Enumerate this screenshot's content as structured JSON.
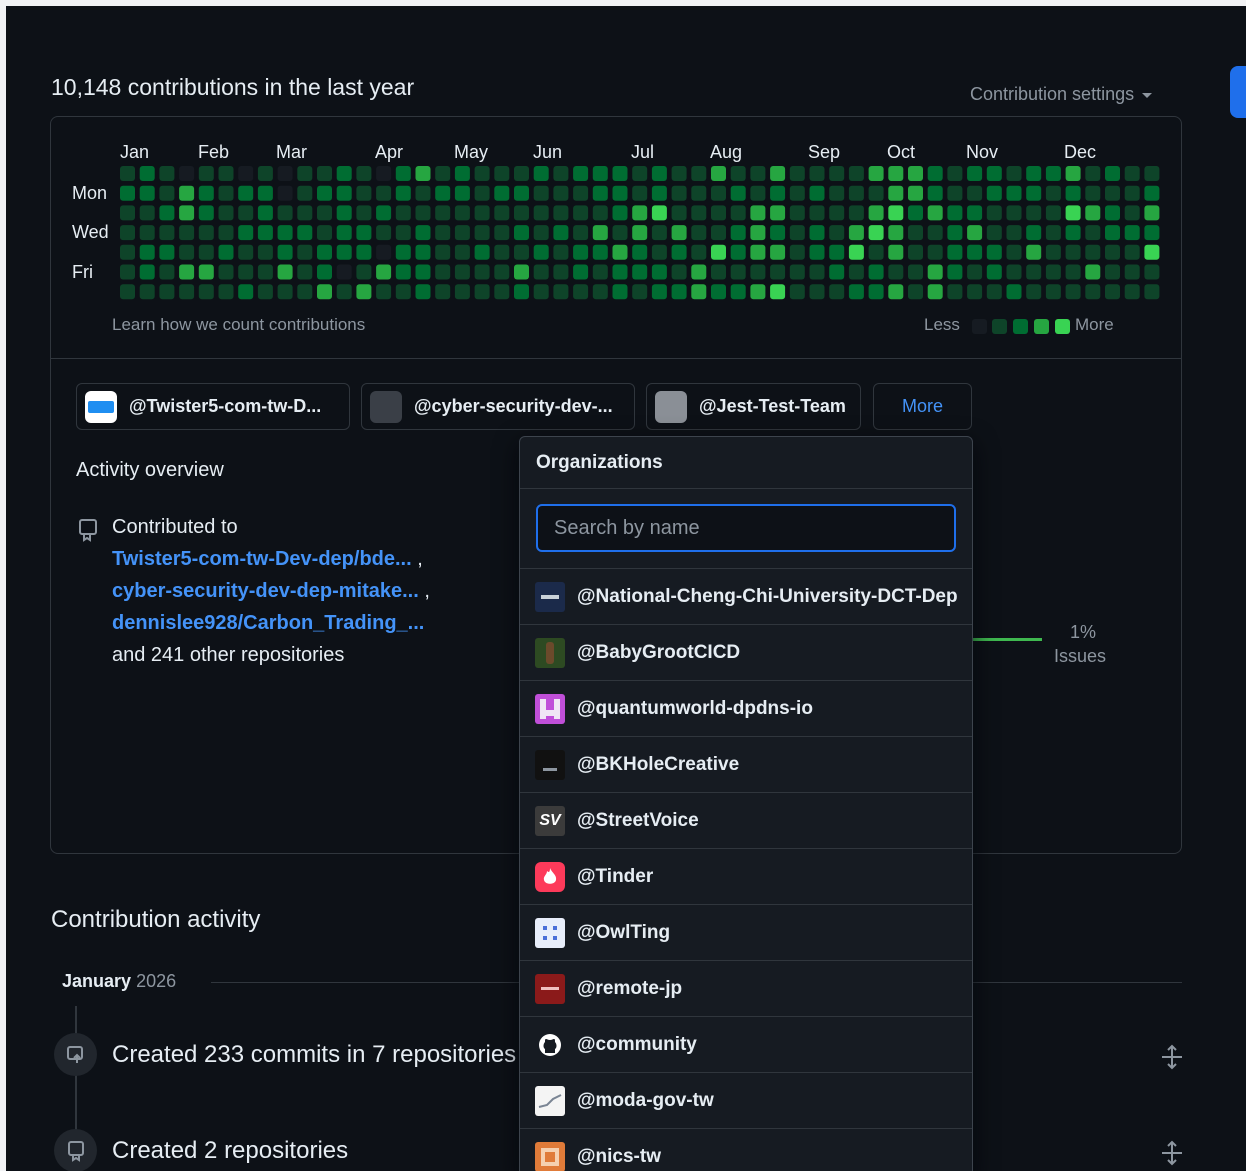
{
  "header": {
    "title": "10,148 contributions in the last year",
    "settings_label": "Contribution settings"
  },
  "calendar": {
    "months": [
      "Jan",
      "Feb",
      "Mar",
      "Apr",
      "May",
      "Jun",
      "Jul",
      "Aug",
      "Sep",
      "Oct",
      "Nov",
      "Dec"
    ],
    "days": [
      "Mon",
      "Wed",
      "Fri"
    ],
    "learn_link": "Learn how we count contributions",
    "legend_less": "Less",
    "legend_more": "More",
    "colors": [
      "#161b22",
      "#0e4429",
      "#006d32",
      "#26a641",
      "#39d353"
    ]
  },
  "org_filters": [
    {
      "label": "@Twister5-com-tw-D...",
      "avatar_color": "#1f8ef1"
    },
    {
      "label": "@cyber-security-dev-...",
      "avatar_color": "#3a3f47"
    },
    {
      "label": "@Jest-Test-Team",
      "avatar_color": "#8a8f96"
    }
  ],
  "more_button": "More",
  "activity": {
    "title": "Activity overview",
    "contributed_to": "Contributed to",
    "repos": [
      "Twister5-com-tw-Dev-dep/bde...",
      "cyber-security-dev-dep-mitake...",
      "dennislee928/Carbon_Trading_..."
    ],
    "comma": ",",
    "others": "and 241 other repositories",
    "issues_pct": "1%",
    "issues_label": "Issues"
  },
  "contribution_activity": {
    "title": "Contribution activity",
    "month": "January",
    "year": "2026",
    "items": [
      {
        "text": "Created 233 commits in 7 repositories"
      },
      {
        "text": "Created 2 repositories"
      }
    ]
  },
  "dropdown": {
    "title": "Organizations",
    "search_placeholder": "Search by name",
    "items": [
      {
        "name": "@National-Cheng-Chi-University-DCT-Dep",
        "icon": "nccu-logo-icon",
        "color": "#1b2a4a"
      },
      {
        "name": "@BabyGrootCICD",
        "icon": "groot-avatar-icon",
        "color": "#2d4a22"
      },
      {
        "name": "@quantumworld-dpdns-io",
        "icon": "quantumworld-identicon",
        "color": "#c04fd9"
      },
      {
        "name": "@BKHoleCreative",
        "icon": "bkhole-logo-icon",
        "color": "#111111"
      },
      {
        "name": "@StreetVoice",
        "icon": "streetvoice-logo-icon",
        "color": "#3b3b3b"
      },
      {
        "name": "@Tinder",
        "icon": "tinder-flame-icon",
        "color": "#fd3a5a"
      },
      {
        "name": "@OwlTing",
        "icon": "owlting-logo-icon",
        "color": "#e8eefb"
      },
      {
        "name": "@remote-jp",
        "icon": "remote-jp-logo-icon",
        "color": "#8b1a1a"
      },
      {
        "name": "@community",
        "icon": "github-mark-icon",
        "color": "#161b22"
      },
      {
        "name": "@moda-gov-tw",
        "icon": "moda-logo-icon",
        "color": "#f4f4f4"
      },
      {
        "name": "@nics-tw",
        "icon": "nics-logo-icon",
        "color": "#e07b39"
      }
    ]
  }
}
